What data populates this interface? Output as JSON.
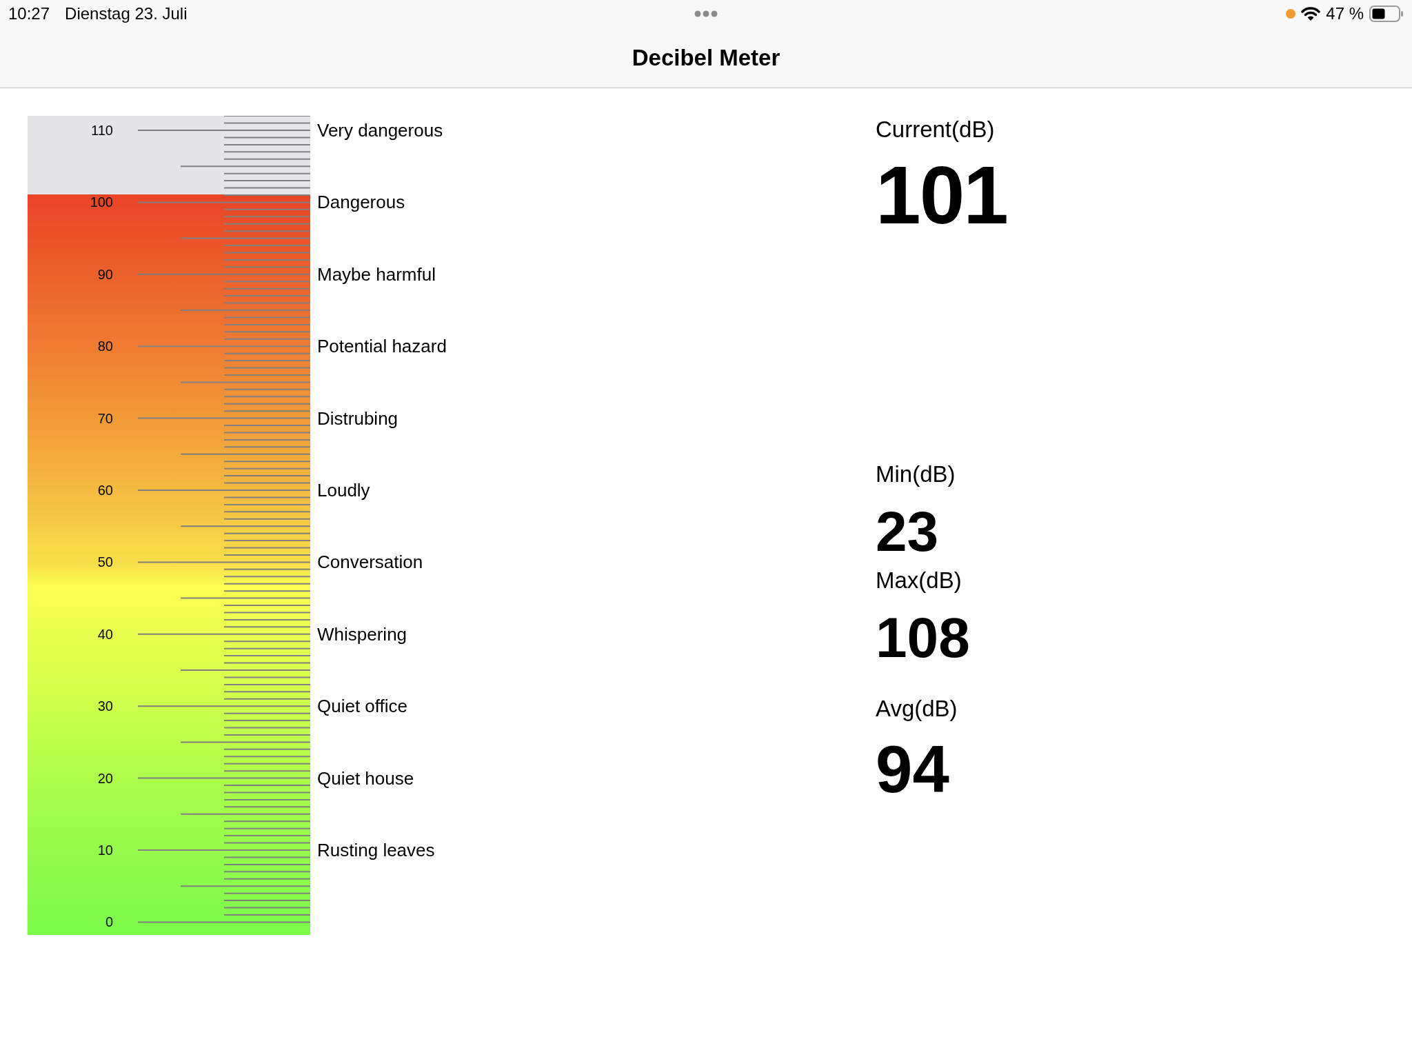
{
  "status_bar": {
    "time": "10:27",
    "date": "Dienstag 23. Juli",
    "battery": "47 %"
  },
  "nav_bar": {
    "title": "Decibel Meter"
  },
  "meter": {
    "level": 0.904,
    "scale": [
      {
        "value": "110",
        "label": "Very dangerous"
      },
      {
        "value": "100",
        "label": "Dangerous"
      },
      {
        "value": "90",
        "label": "Maybe harmful"
      },
      {
        "value": "80",
        "label": "Potential hazard"
      },
      {
        "value": "70",
        "label": "Distrubing"
      },
      {
        "value": "60",
        "label": "Loudly"
      },
      {
        "value": "50",
        "label": "Conversation"
      },
      {
        "value": "40",
        "label": "Whispering"
      },
      {
        "value": "30",
        "label": "Quiet office"
      },
      {
        "value": "20",
        "label": "Quiet house"
      },
      {
        "value": "10",
        "label": "Rusting leaves"
      },
      {
        "value": "0"
      }
    ]
  },
  "readings": [
    {
      "kind": "current",
      "label": "Current(dB)",
      "value": "101"
    },
    {
      "kind": "stat",
      "label": "Min(dB)",
      "value": "23"
    },
    {
      "kind": "stat",
      "label": "Max(dB)",
      "value": "108"
    },
    {
      "kind": "avg",
      "label": "Avg(dB)",
      "value": "94"
    }
  ]
}
